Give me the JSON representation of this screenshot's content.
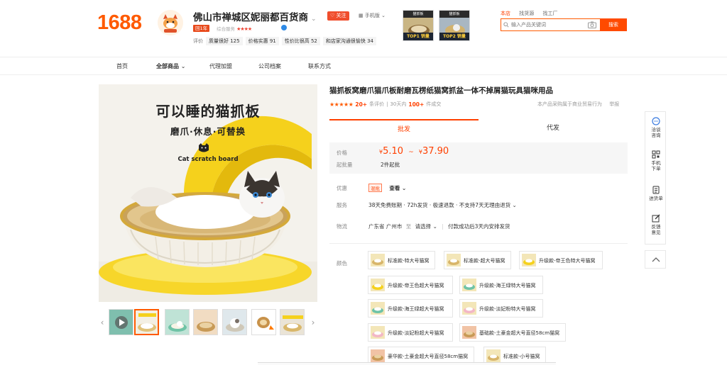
{
  "header": {
    "logo": "1688",
    "shop_name": "佛山市禅城区妮丽都百货商",
    "shop_badge": "回1年",
    "shop_rating_label": "综合服务",
    "shop_rating_stars": "★★★★",
    "follow_label": "关注",
    "phone_label": "手机版",
    "ratings_label": "评价",
    "ratings": [
      "质量很好 125",
      "价格实惠 91",
      "性价比很高 52",
      "和店家沟通很愉快 34"
    ],
    "promos": [
      "TOP1 销量",
      "TOP2 销量"
    ],
    "search_tabs": [
      "本店",
      "找货源",
      "找工厂"
    ],
    "search_placeholder": "输入产品关键词",
    "search_button": "搜索"
  },
  "nav": [
    "首页",
    "全部商品",
    "代理加盟",
    "公司档案",
    "联系方式"
  ],
  "gallery": {
    "headline": "可以睡的猫抓板",
    "subline": "磨爪·休息·可替换",
    "english": "Cat scratch board",
    "thumbnail_count": 7
  },
  "product": {
    "title": "猫抓板窝磨爪猫爪板耐磨瓦楞纸猫窝抓盆一体不掉屑猫玩具猫咪用品",
    "stars": "★★★★★",
    "reviews_count": "20+",
    "reviews_label": "条评价",
    "sales_period": "30天内",
    "sales_count": "100+",
    "sales_label": "件成交",
    "proxy_note": "本产品采购属于商业贸易行为",
    "report_label": "举报",
    "tabs": [
      "批发",
      "代发"
    ],
    "price_label": "价格",
    "price_low": "5.10",
    "price_sep": "~",
    "price_high": "37.90",
    "currency": "¥",
    "moq_label": "起批量",
    "moq_value": "2件起批",
    "discount_label": "优惠",
    "discount_tag": "混批",
    "discount_view": "查看",
    "service_label": "服务",
    "service_value": "38天免费账期 · 72h发货 · 极速退款 · 不支持7天无理由退货",
    "logistics_label": "物流",
    "logistics_from": "广东省 广州市",
    "logistics_to_word": "至",
    "logistics_select": "请选择",
    "logistics_note": "付款成功后3天内安排发货",
    "color_label": "颜色",
    "variants": [
      "标准款-特大号猫窝",
      "标准款-超大号猫窝",
      "升级款-帝王色特大号猫窝",
      "升级款-帝王色超大号猫窝",
      "升级款-海王绿特大号猫窝",
      "升级款-海王绿超大号猫窝",
      "升级款-淡妃粉特大号猫窝",
      "升级款-淡妃粉超大号猫窝",
      "基础款-土豪金超大号直径58cm猫窝",
      "豪华款-土豪金超大号直径58cm猫窝",
      "标准款-小号猫窝"
    ]
  },
  "side_tools": [
    "咨询",
    "手机下单",
    "进货单",
    "反馈意见"
  ],
  "side_tools_lines": [
    [
      "洽谈",
      "咨询"
    ],
    [
      "手机",
      "下单"
    ],
    [
      "进货单",
      ""
    ],
    [
      "反馈",
      "意见"
    ]
  ],
  "colors": {
    "accent": "#ff4000",
    "brand": "#ff5a00"
  }
}
